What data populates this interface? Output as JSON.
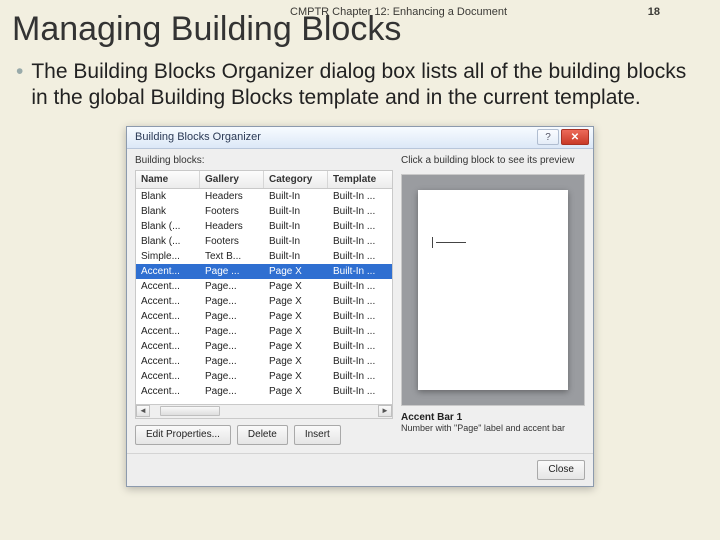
{
  "chapter": "CMPTR Chapter 12: Enhancing a Document",
  "page_number": "18",
  "slide_title": "Managing Building Blocks",
  "bullet_text": "The Building Blocks Organizer dialog box lists all of the building blocks in the global Building Blocks template and in the current template.",
  "dialog": {
    "title": "Building Blocks Organizer",
    "left_label": "Building blocks:",
    "right_label": "Click a building block to see its preview",
    "columns": [
      "Name",
      "Gallery",
      "Category",
      "Template"
    ],
    "rows": [
      {
        "c": [
          "Blank",
          "Headers",
          "Built-In",
          "Built-In ..."
        ],
        "sel": false
      },
      {
        "c": [
          "Blank",
          "Footers",
          "Built-In",
          "Built-In ..."
        ],
        "sel": false
      },
      {
        "c": [
          "Blank (...",
          "Headers",
          "Built-In",
          "Built-In ..."
        ],
        "sel": false
      },
      {
        "c": [
          "Blank (...",
          "Footers",
          "Built-In",
          "Built-In ..."
        ],
        "sel": false
      },
      {
        "c": [
          "Simple...",
          "Text B...",
          "Built-In",
          "Built-In ..."
        ],
        "sel": false
      },
      {
        "c": [
          "Accent...",
          "Page ...",
          "Page X",
          "Built-In ..."
        ],
        "sel": true
      },
      {
        "c": [
          "Accent...",
          "Page...",
          "Page X",
          "Built-In ..."
        ],
        "sel": false
      },
      {
        "c": [
          "Accent...",
          "Page...",
          "Page X",
          "Built-In ..."
        ],
        "sel": false
      },
      {
        "c": [
          "Accent...",
          "Page...",
          "Page X",
          "Built-In ..."
        ],
        "sel": false
      },
      {
        "c": [
          "Accent...",
          "Page...",
          "Page X",
          "Built-In ..."
        ],
        "sel": false
      },
      {
        "c": [
          "Accent...",
          "Page...",
          "Page X",
          "Built-In ..."
        ],
        "sel": false
      },
      {
        "c": [
          "Accent...",
          "Page...",
          "Page X",
          "Built-In ..."
        ],
        "sel": false
      },
      {
        "c": [
          "Accent...",
          "Page...",
          "Page X",
          "Built-In ..."
        ],
        "sel": false
      },
      {
        "c": [
          "Accent...",
          "Page...",
          "Page X",
          "Built-In ..."
        ],
        "sel": false
      }
    ],
    "buttons": {
      "edit": "Edit Properties...",
      "delete": "Delete",
      "insert": "Insert",
      "close": "Close"
    },
    "preview": {
      "name": "Accent Bar 1",
      "desc": "Number with \"Page\" label and accent bar"
    }
  }
}
